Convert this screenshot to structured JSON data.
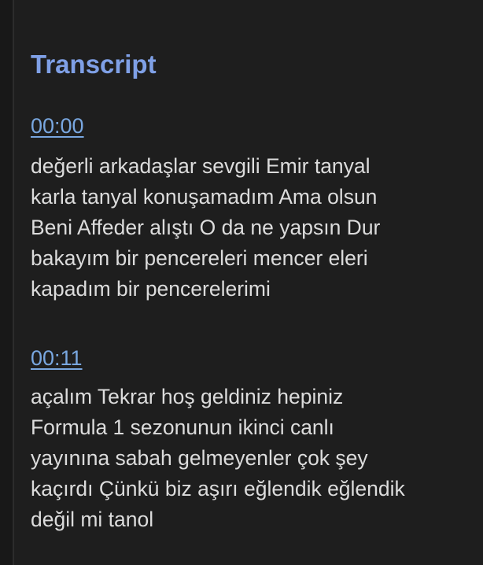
{
  "transcript": {
    "title": "Transcript",
    "entries": [
      {
        "time": "00:00",
        "lines": [
          "değerli arkadaşlar sevgili Emir tanyal",
          "karla tanyal konuşamadım Ama olsun",
          "Beni Affeder alıştı O da ne yapsın Dur",
          "bakayım bir pencereleri mencer eleri",
          "kapadım bir pencerelerimi"
        ]
      },
      {
        "time": "00:11",
        "lines": [
          "açalım Tekrar hoş geldiniz hepiniz",
          "Formula 1 sezonunun ikinci canlı",
          "yayınına sabah gelmeyenler çok şey",
          "kaçırdı Çünkü biz aşırı eğlendik eğlendik",
          "değil mi tanol"
        ]
      }
    ]
  },
  "colors": {
    "background": "#1e1e1e",
    "title": "#7fa0e6",
    "link": "#79a7e0",
    "text": "#dcdcdc"
  }
}
